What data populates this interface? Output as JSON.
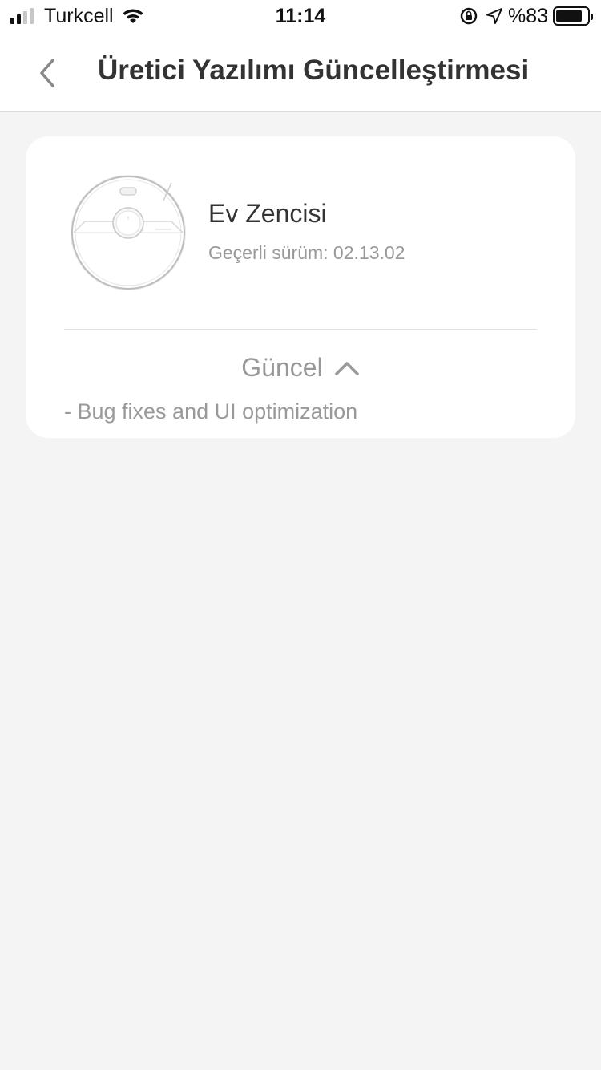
{
  "status_bar": {
    "carrier": "Turkcell",
    "time": "11:14",
    "battery_percent": "%83",
    "battery_level": 0.83,
    "signal_bars_active": 2,
    "signal_bars_total": 4
  },
  "nav": {
    "title": "Üretici Yazılımı Güncelleştirmesi",
    "back_icon": "chevron-left-icon"
  },
  "device": {
    "name": "Ev Zencisi",
    "version_text": "Geçerli sürüm: 02.13.02",
    "image": "robot-vacuum-image"
  },
  "update": {
    "status_label": "Güncel",
    "toggle_icon": "chevron-up-icon",
    "notes": "- Bug fixes and UI optimization"
  },
  "colors": {
    "background": "#f4f4f4",
    "card": "#ffffff",
    "title_text": "#333333",
    "secondary_text": "#999999"
  }
}
